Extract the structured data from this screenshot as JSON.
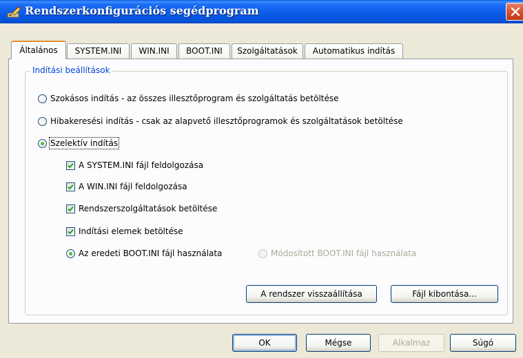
{
  "window": {
    "title": "Rendszerkonfigurációs segédprogram",
    "icon": "system-config-icon",
    "close_icon": "close-icon"
  },
  "tabs": [
    {
      "label": "Általános",
      "active": true
    },
    {
      "label": "SYSTEM.INI",
      "active": false
    },
    {
      "label": "WIN.INI",
      "active": false
    },
    {
      "label": "BOOT.INI",
      "active": false
    },
    {
      "label": "Szolgáltatások",
      "active": false
    },
    {
      "label": "Automatikus indítás",
      "active": false
    }
  ],
  "startup_group": {
    "label": "Indítási beállítások",
    "options": [
      {
        "label": "Szokásos indítás - az összes illesztőprogram és szolgáltatás betöltése",
        "checked": false
      },
      {
        "label": "Hibakeresési indítás - csak az alapvető illesztőprogramok és szolgáltatások betöltése",
        "checked": false
      },
      {
        "label": "Szelektív indítás",
        "checked": true
      }
    ],
    "selective_items": [
      {
        "label": "A SYSTEM.INI fájl feldolgozása",
        "checked": true
      },
      {
        "label": "A WIN.INI fájl feldolgozása",
        "checked": true
      },
      {
        "label": "Rendszerszolgáltatások betöltése",
        "checked": true
      },
      {
        "label": "Indítási elemek betöltése",
        "checked": true
      }
    ],
    "boot_options": [
      {
        "label": "Az eredeti BOOT.INI fájl használata",
        "checked": true,
        "enabled": true
      },
      {
        "label": "Módosított BOOT.INI fájl használata",
        "checked": false,
        "enabled": false
      }
    ],
    "restore_button": "A rendszer visszaállítása",
    "extract_button": "Fájl kibontása..."
  },
  "footer": {
    "ok": "OK",
    "cancel": "Mégse",
    "apply": "Alkalmaz",
    "help": "Súgó"
  },
  "colors": {
    "titlebar": "#0a5ae8",
    "group_label": "#0046d5",
    "active_tab_accent": "#e68b2c",
    "checkmark": "#21a121"
  }
}
